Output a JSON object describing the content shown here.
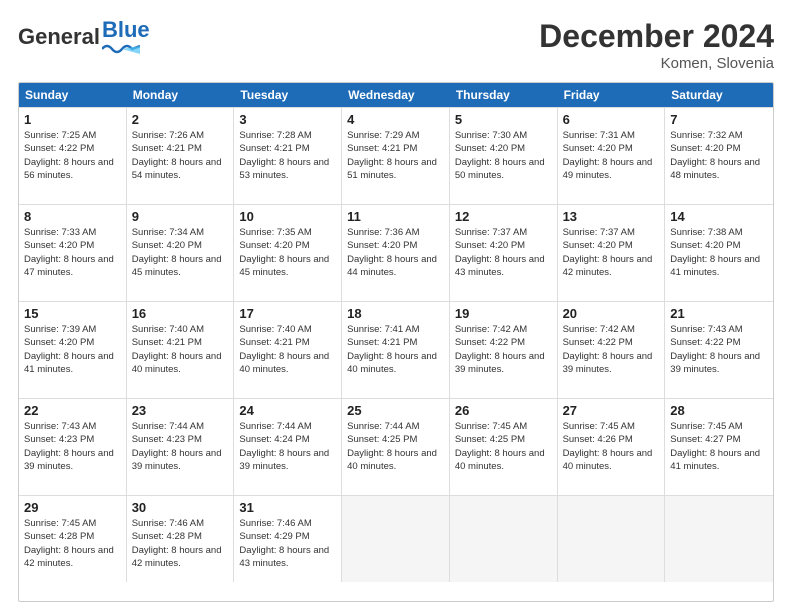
{
  "header": {
    "logo_general": "General",
    "logo_blue": "Blue",
    "title": "December 2024",
    "subtitle": "Komen, Slovenia"
  },
  "calendar": {
    "days_of_week": [
      "Sunday",
      "Monday",
      "Tuesday",
      "Wednesday",
      "Thursday",
      "Friday",
      "Saturday"
    ],
    "weeks": [
      [
        {
          "day": "1",
          "sunrise": "Sunrise: 7:25 AM",
          "sunset": "Sunset: 4:22 PM",
          "daylight": "Daylight: 8 hours and 56 minutes."
        },
        {
          "day": "2",
          "sunrise": "Sunrise: 7:26 AM",
          "sunset": "Sunset: 4:21 PM",
          "daylight": "Daylight: 8 hours and 54 minutes."
        },
        {
          "day": "3",
          "sunrise": "Sunrise: 7:28 AM",
          "sunset": "Sunset: 4:21 PM",
          "daylight": "Daylight: 8 hours and 53 minutes."
        },
        {
          "day": "4",
          "sunrise": "Sunrise: 7:29 AM",
          "sunset": "Sunset: 4:21 PM",
          "daylight": "Daylight: 8 hours and 51 minutes."
        },
        {
          "day": "5",
          "sunrise": "Sunrise: 7:30 AM",
          "sunset": "Sunset: 4:20 PM",
          "daylight": "Daylight: 8 hours and 50 minutes."
        },
        {
          "day": "6",
          "sunrise": "Sunrise: 7:31 AM",
          "sunset": "Sunset: 4:20 PM",
          "daylight": "Daylight: 8 hours and 49 minutes."
        },
        {
          "day": "7",
          "sunrise": "Sunrise: 7:32 AM",
          "sunset": "Sunset: 4:20 PM",
          "daylight": "Daylight: 8 hours and 48 minutes."
        }
      ],
      [
        {
          "day": "8",
          "sunrise": "Sunrise: 7:33 AM",
          "sunset": "Sunset: 4:20 PM",
          "daylight": "Daylight: 8 hours and 47 minutes."
        },
        {
          "day": "9",
          "sunrise": "Sunrise: 7:34 AM",
          "sunset": "Sunset: 4:20 PM",
          "daylight": "Daylight: 8 hours and 45 minutes."
        },
        {
          "day": "10",
          "sunrise": "Sunrise: 7:35 AM",
          "sunset": "Sunset: 4:20 PM",
          "daylight": "Daylight: 8 hours and 45 minutes."
        },
        {
          "day": "11",
          "sunrise": "Sunrise: 7:36 AM",
          "sunset": "Sunset: 4:20 PM",
          "daylight": "Daylight: 8 hours and 44 minutes."
        },
        {
          "day": "12",
          "sunrise": "Sunrise: 7:37 AM",
          "sunset": "Sunset: 4:20 PM",
          "daylight": "Daylight: 8 hours and 43 minutes."
        },
        {
          "day": "13",
          "sunrise": "Sunrise: 7:37 AM",
          "sunset": "Sunset: 4:20 PM",
          "daylight": "Daylight: 8 hours and 42 minutes."
        },
        {
          "day": "14",
          "sunrise": "Sunrise: 7:38 AM",
          "sunset": "Sunset: 4:20 PM",
          "daylight": "Daylight: 8 hours and 41 minutes."
        }
      ],
      [
        {
          "day": "15",
          "sunrise": "Sunrise: 7:39 AM",
          "sunset": "Sunset: 4:20 PM",
          "daylight": "Daylight: 8 hours and 41 minutes."
        },
        {
          "day": "16",
          "sunrise": "Sunrise: 7:40 AM",
          "sunset": "Sunset: 4:21 PM",
          "daylight": "Daylight: 8 hours and 40 minutes."
        },
        {
          "day": "17",
          "sunrise": "Sunrise: 7:40 AM",
          "sunset": "Sunset: 4:21 PM",
          "daylight": "Daylight: 8 hours and 40 minutes."
        },
        {
          "day": "18",
          "sunrise": "Sunrise: 7:41 AM",
          "sunset": "Sunset: 4:21 PM",
          "daylight": "Daylight: 8 hours and 40 minutes."
        },
        {
          "day": "19",
          "sunrise": "Sunrise: 7:42 AM",
          "sunset": "Sunset: 4:22 PM",
          "daylight": "Daylight: 8 hours and 39 minutes."
        },
        {
          "day": "20",
          "sunrise": "Sunrise: 7:42 AM",
          "sunset": "Sunset: 4:22 PM",
          "daylight": "Daylight: 8 hours and 39 minutes."
        },
        {
          "day": "21",
          "sunrise": "Sunrise: 7:43 AM",
          "sunset": "Sunset: 4:22 PM",
          "daylight": "Daylight: 8 hours and 39 minutes."
        }
      ],
      [
        {
          "day": "22",
          "sunrise": "Sunrise: 7:43 AM",
          "sunset": "Sunset: 4:23 PM",
          "daylight": "Daylight: 8 hours and 39 minutes."
        },
        {
          "day": "23",
          "sunrise": "Sunrise: 7:44 AM",
          "sunset": "Sunset: 4:23 PM",
          "daylight": "Daylight: 8 hours and 39 minutes."
        },
        {
          "day": "24",
          "sunrise": "Sunrise: 7:44 AM",
          "sunset": "Sunset: 4:24 PM",
          "daylight": "Daylight: 8 hours and 39 minutes."
        },
        {
          "day": "25",
          "sunrise": "Sunrise: 7:44 AM",
          "sunset": "Sunset: 4:25 PM",
          "daylight": "Daylight: 8 hours and 40 minutes."
        },
        {
          "day": "26",
          "sunrise": "Sunrise: 7:45 AM",
          "sunset": "Sunset: 4:25 PM",
          "daylight": "Daylight: 8 hours and 40 minutes."
        },
        {
          "day": "27",
          "sunrise": "Sunrise: 7:45 AM",
          "sunset": "Sunset: 4:26 PM",
          "daylight": "Daylight: 8 hours and 40 minutes."
        },
        {
          "day": "28",
          "sunrise": "Sunrise: 7:45 AM",
          "sunset": "Sunset: 4:27 PM",
          "daylight": "Daylight: 8 hours and 41 minutes."
        }
      ],
      [
        {
          "day": "29",
          "sunrise": "Sunrise: 7:45 AM",
          "sunset": "Sunset: 4:28 PM",
          "daylight": "Daylight: 8 hours and 42 minutes."
        },
        {
          "day": "30",
          "sunrise": "Sunrise: 7:46 AM",
          "sunset": "Sunset: 4:28 PM",
          "daylight": "Daylight: 8 hours and 42 minutes."
        },
        {
          "day": "31",
          "sunrise": "Sunrise: 7:46 AM",
          "sunset": "Sunset: 4:29 PM",
          "daylight": "Daylight: 8 hours and 43 minutes."
        },
        {
          "day": "",
          "sunrise": "",
          "sunset": "",
          "daylight": ""
        },
        {
          "day": "",
          "sunrise": "",
          "sunset": "",
          "daylight": ""
        },
        {
          "day": "",
          "sunrise": "",
          "sunset": "",
          "daylight": ""
        },
        {
          "day": "",
          "sunrise": "",
          "sunset": "",
          "daylight": ""
        }
      ]
    ]
  }
}
